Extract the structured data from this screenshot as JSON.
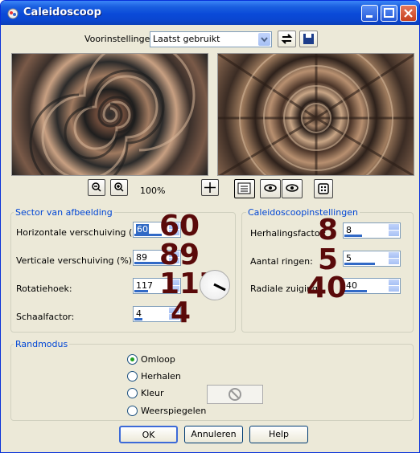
{
  "window": {
    "title": "Caleidoscoop"
  },
  "presets": {
    "label": "Voorinstellingen:",
    "value": "Laatst gebruikt"
  },
  "zoom": {
    "level": "100%"
  },
  "sector": {
    "title": "Sector van afbeelding",
    "horizontal": {
      "label": "Horizontale verschuiving (%):",
      "value": "60",
      "big": "60"
    },
    "vertical": {
      "label": "Verticale verschuiving (%):",
      "value": "89",
      "big": "89"
    },
    "rotation": {
      "label": "Rotatiehoek:",
      "value": "117",
      "big": "117"
    },
    "scale": {
      "label": "Schaalfactor:",
      "value": "4",
      "big": "4"
    }
  },
  "kaleido": {
    "title": "Caleidoscoopinstellingen",
    "repeat": {
      "label": "Herhalingsfactor:",
      "value": "8",
      "big": "8"
    },
    "rings": {
      "label": "Aantal ringen:",
      "value": "5",
      "big": "5"
    },
    "radial": {
      "label": "Radiale zuiging:",
      "value": "40",
      "big": "40"
    }
  },
  "edge": {
    "title": "Randmodus",
    "options": [
      "Omloop",
      "Herhalen",
      "Kleur",
      "Weerspiegelen"
    ],
    "selected": "Omloop"
  },
  "buttons": {
    "ok": "OK",
    "cancel": "Annuleren",
    "help": "Help"
  },
  "colors": {
    "titlebar": "#0a4ad8",
    "group_title": "#0046d5",
    "big_number": "#5a0a0a"
  }
}
